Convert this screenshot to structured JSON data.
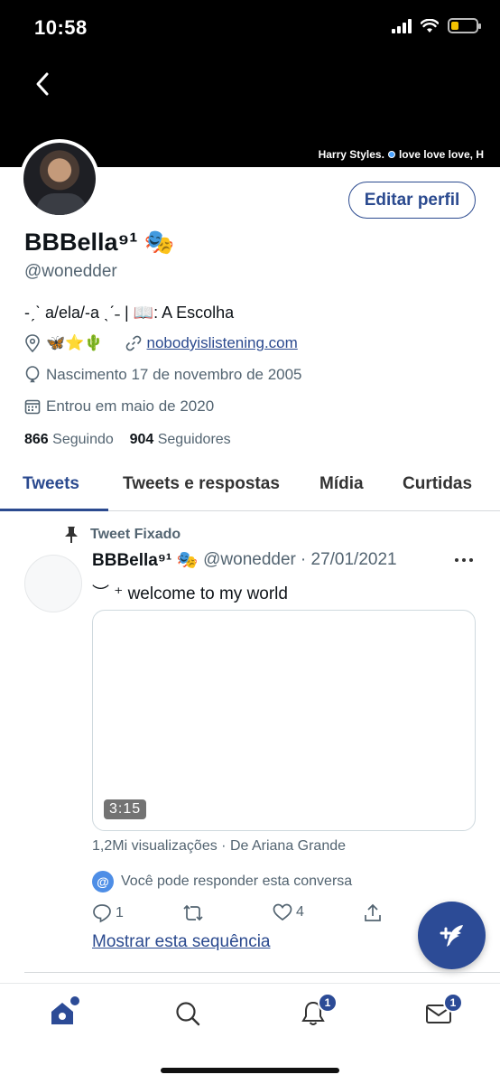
{
  "status_bar": {
    "time": "10:58"
  },
  "header": {
    "now_playing_artist": "Harry Styles.",
    "now_playing_text": "love love love, H"
  },
  "profile": {
    "name": "BBBella⁹¹ 🎭",
    "handle": "@wonedder",
    "edit_button": "Editar perfil",
    "bio": "-ˏˋ a/ela/-a ˎˊ˗ | 📖: A Escolha",
    "location": "🦋⭐🌵",
    "website": "nobodyislistening.com",
    "birthday": "Nascimento 17 de novembro de 2005",
    "joined": "Entrou em maio de 2020",
    "following_count": "866",
    "following_label": "Seguindo",
    "followers_count": "904",
    "followers_label": "Seguidores"
  },
  "tabs": [
    {
      "label": "Tweets"
    },
    {
      "label": "Tweets e respostas"
    },
    {
      "label": "Mídia"
    },
    {
      "label": "Curtidas"
    }
  ],
  "tweet": {
    "pinned_label": "Tweet Fixado",
    "author_name": "BBBella⁹¹ 🎭",
    "author_handle": "@wonedder",
    "date": "· 27/01/2021",
    "text": "︶ ⁺ welcome to my world",
    "video_duration": "3:15",
    "views": "1,2Mi visualizações · De Ariana Grande",
    "reply_info": "Você pode responder esta conversa",
    "reply_count": "1",
    "like_count": "4",
    "show_thread": "Mostrar esta sequência"
  },
  "bottom_nav": {
    "notifications_badge": "1",
    "messages_badge": "1"
  },
  "colors": {
    "accent": "#2b4a8f",
    "header_bg": "#000000",
    "muted": "#536471"
  }
}
